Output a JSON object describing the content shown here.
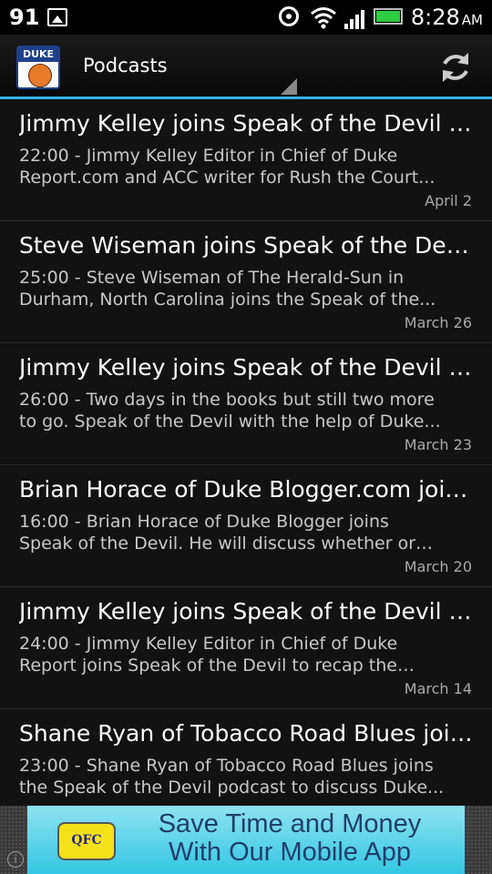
{
  "status_bar": {
    "left_number": "91",
    "time": "8:28",
    "ampm": "AM"
  },
  "action_bar": {
    "logo_text": "DUKE",
    "title": "Podcasts"
  },
  "podcasts": [
    {
      "title": "Jimmy Kelley joins Speak of the Devil  -...",
      "description": "22:00 - Jimmy Kelley Editor in Chief of Duke Report.com and ACC writer for Rush the Court...",
      "date": "April 2"
    },
    {
      "title": "Steve Wiseman joins Speak of the Devil...",
      "description": "25:00 - Steve Wiseman of The Herald-Sun in Durham, North Carolina joins the Speak of the...",
      "date": "March 26"
    },
    {
      "title": "Jimmy Kelley joins Speak of the Devil  -...",
      "description": "26:00 - Two days in the books but still two more to go. Speak of the Devil with the help of Duke...",
      "date": "March 23"
    },
    {
      "title": "Brian Horace of Duke Blogger.com joins...",
      "description": "16:00 - Brian Horace of Duke Blogger joins Speak of the Devil. He will discuss whether or not Duke...",
      "date": "March 20"
    },
    {
      "title": "Jimmy Kelley joins Speak of the Devil  -...",
      "description": "24:00 - Jimmy Kelley Editor in Chief of Duke Report joins Speak of the Devil to recap the regular...",
      "date": "March 14"
    },
    {
      "title": "Shane Ryan of Tobacco Road Blues join...",
      "description": "23:00 - Shane Ryan of Tobacco Road Blues joins the Speak of the Devil podcast to discuss Duke...",
      "date": ""
    }
  ],
  "ad": {
    "logo_text": "QFC",
    "line1": "Save Time and Money",
    "line2": "With Our Mobile App"
  },
  "colors": {
    "accent": "#33b5e5",
    "battery": "#2ecc40",
    "ad_background": "#34c7e3"
  }
}
